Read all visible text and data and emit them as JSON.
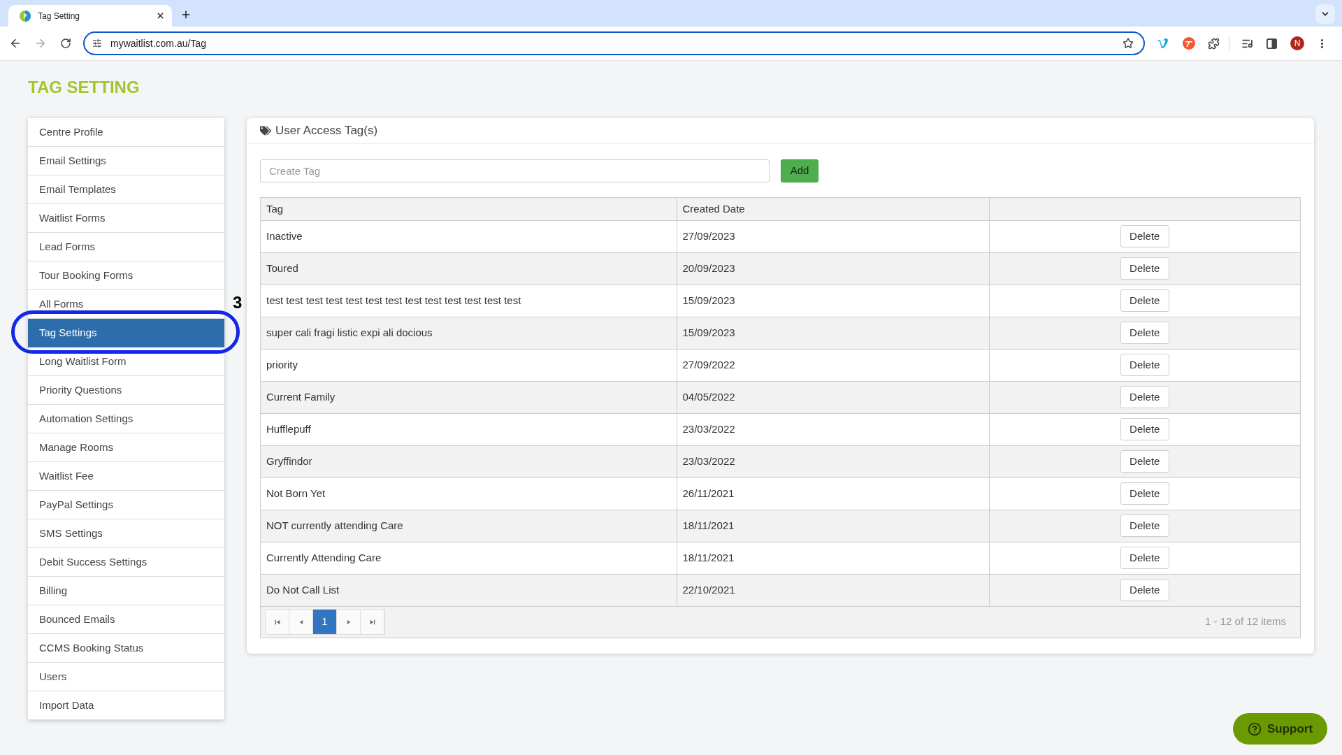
{
  "browser": {
    "tab": {
      "title": "Tag Setting"
    },
    "address": "mywaitlist.com.au/Tag",
    "profile_initial": "N"
  },
  "page": {
    "title": "TAG SETTING"
  },
  "sidebar": {
    "items": [
      {
        "label": "Centre Profile",
        "selected": false
      },
      {
        "label": "Email Settings",
        "selected": false
      },
      {
        "label": "Email Templates",
        "selected": false
      },
      {
        "label": "Waitlist Forms",
        "selected": false
      },
      {
        "label": "Lead Forms",
        "selected": false
      },
      {
        "label": "Tour Booking Forms",
        "selected": false
      },
      {
        "label": "All Forms",
        "selected": false
      },
      {
        "label": "Tag Settings",
        "selected": true
      },
      {
        "label": "Long Waitlist Form",
        "selected": false
      },
      {
        "label": "Priority Questions",
        "selected": false
      },
      {
        "label": "Automation Settings",
        "selected": false
      },
      {
        "label": "Manage Rooms",
        "selected": false
      },
      {
        "label": "Waitlist Fee",
        "selected": false
      },
      {
        "label": "PayPal Settings",
        "selected": false
      },
      {
        "label": "SMS Settings",
        "selected": false
      },
      {
        "label": "Debit Success Settings",
        "selected": false
      },
      {
        "label": "Billing",
        "selected": false
      },
      {
        "label": "Bounced Emails",
        "selected": false
      },
      {
        "label": "CCMS Booking Status",
        "selected": false
      },
      {
        "label": "Users",
        "selected": false
      },
      {
        "label": "Import Data",
        "selected": false
      }
    ]
  },
  "annotation": {
    "label": "3"
  },
  "panel": {
    "title": "User Access Tag(s)",
    "create_field": {
      "placeholder": "Create Tag"
    },
    "add_button": "Add"
  },
  "table": {
    "columns": [
      "Tag",
      "Created Date"
    ],
    "rows": [
      {
        "tag": "Inactive",
        "created_date": "27/09/2023",
        "action": "Delete"
      },
      {
        "tag": "Toured",
        "created_date": "20/09/2023",
        "action": "Delete"
      },
      {
        "tag": "test test test test test test test test test test test test test",
        "created_date": "15/09/2023",
        "action": "Delete"
      },
      {
        "tag": "super cali fragi listic expi ali docious",
        "created_date": "15/09/2023",
        "action": "Delete"
      },
      {
        "tag": "priority",
        "created_date": "27/09/2022",
        "action": "Delete"
      },
      {
        "tag": "Current Family",
        "created_date": "04/05/2022",
        "action": "Delete"
      },
      {
        "tag": "Hufflepuff",
        "created_date": "23/03/2022",
        "action": "Delete"
      },
      {
        "tag": "Gryffindor",
        "created_date": "23/03/2022",
        "action": "Delete"
      },
      {
        "tag": "Not Born Yet",
        "created_date": "26/11/2021",
        "action": "Delete"
      },
      {
        "tag": "NOT currently attending Care",
        "created_date": "18/11/2021",
        "action": "Delete"
      },
      {
        "tag": "Currently Attending Care",
        "created_date": "18/11/2021",
        "action": "Delete"
      },
      {
        "tag": "Do Not Call List",
        "created_date": "22/10/2021",
        "action": "Delete"
      }
    ]
  },
  "pagination": {
    "pages": [
      {
        "label": "1",
        "selected": true
      }
    ],
    "summary": "1 - 12 of 12 items"
  },
  "support_button": "Support"
}
